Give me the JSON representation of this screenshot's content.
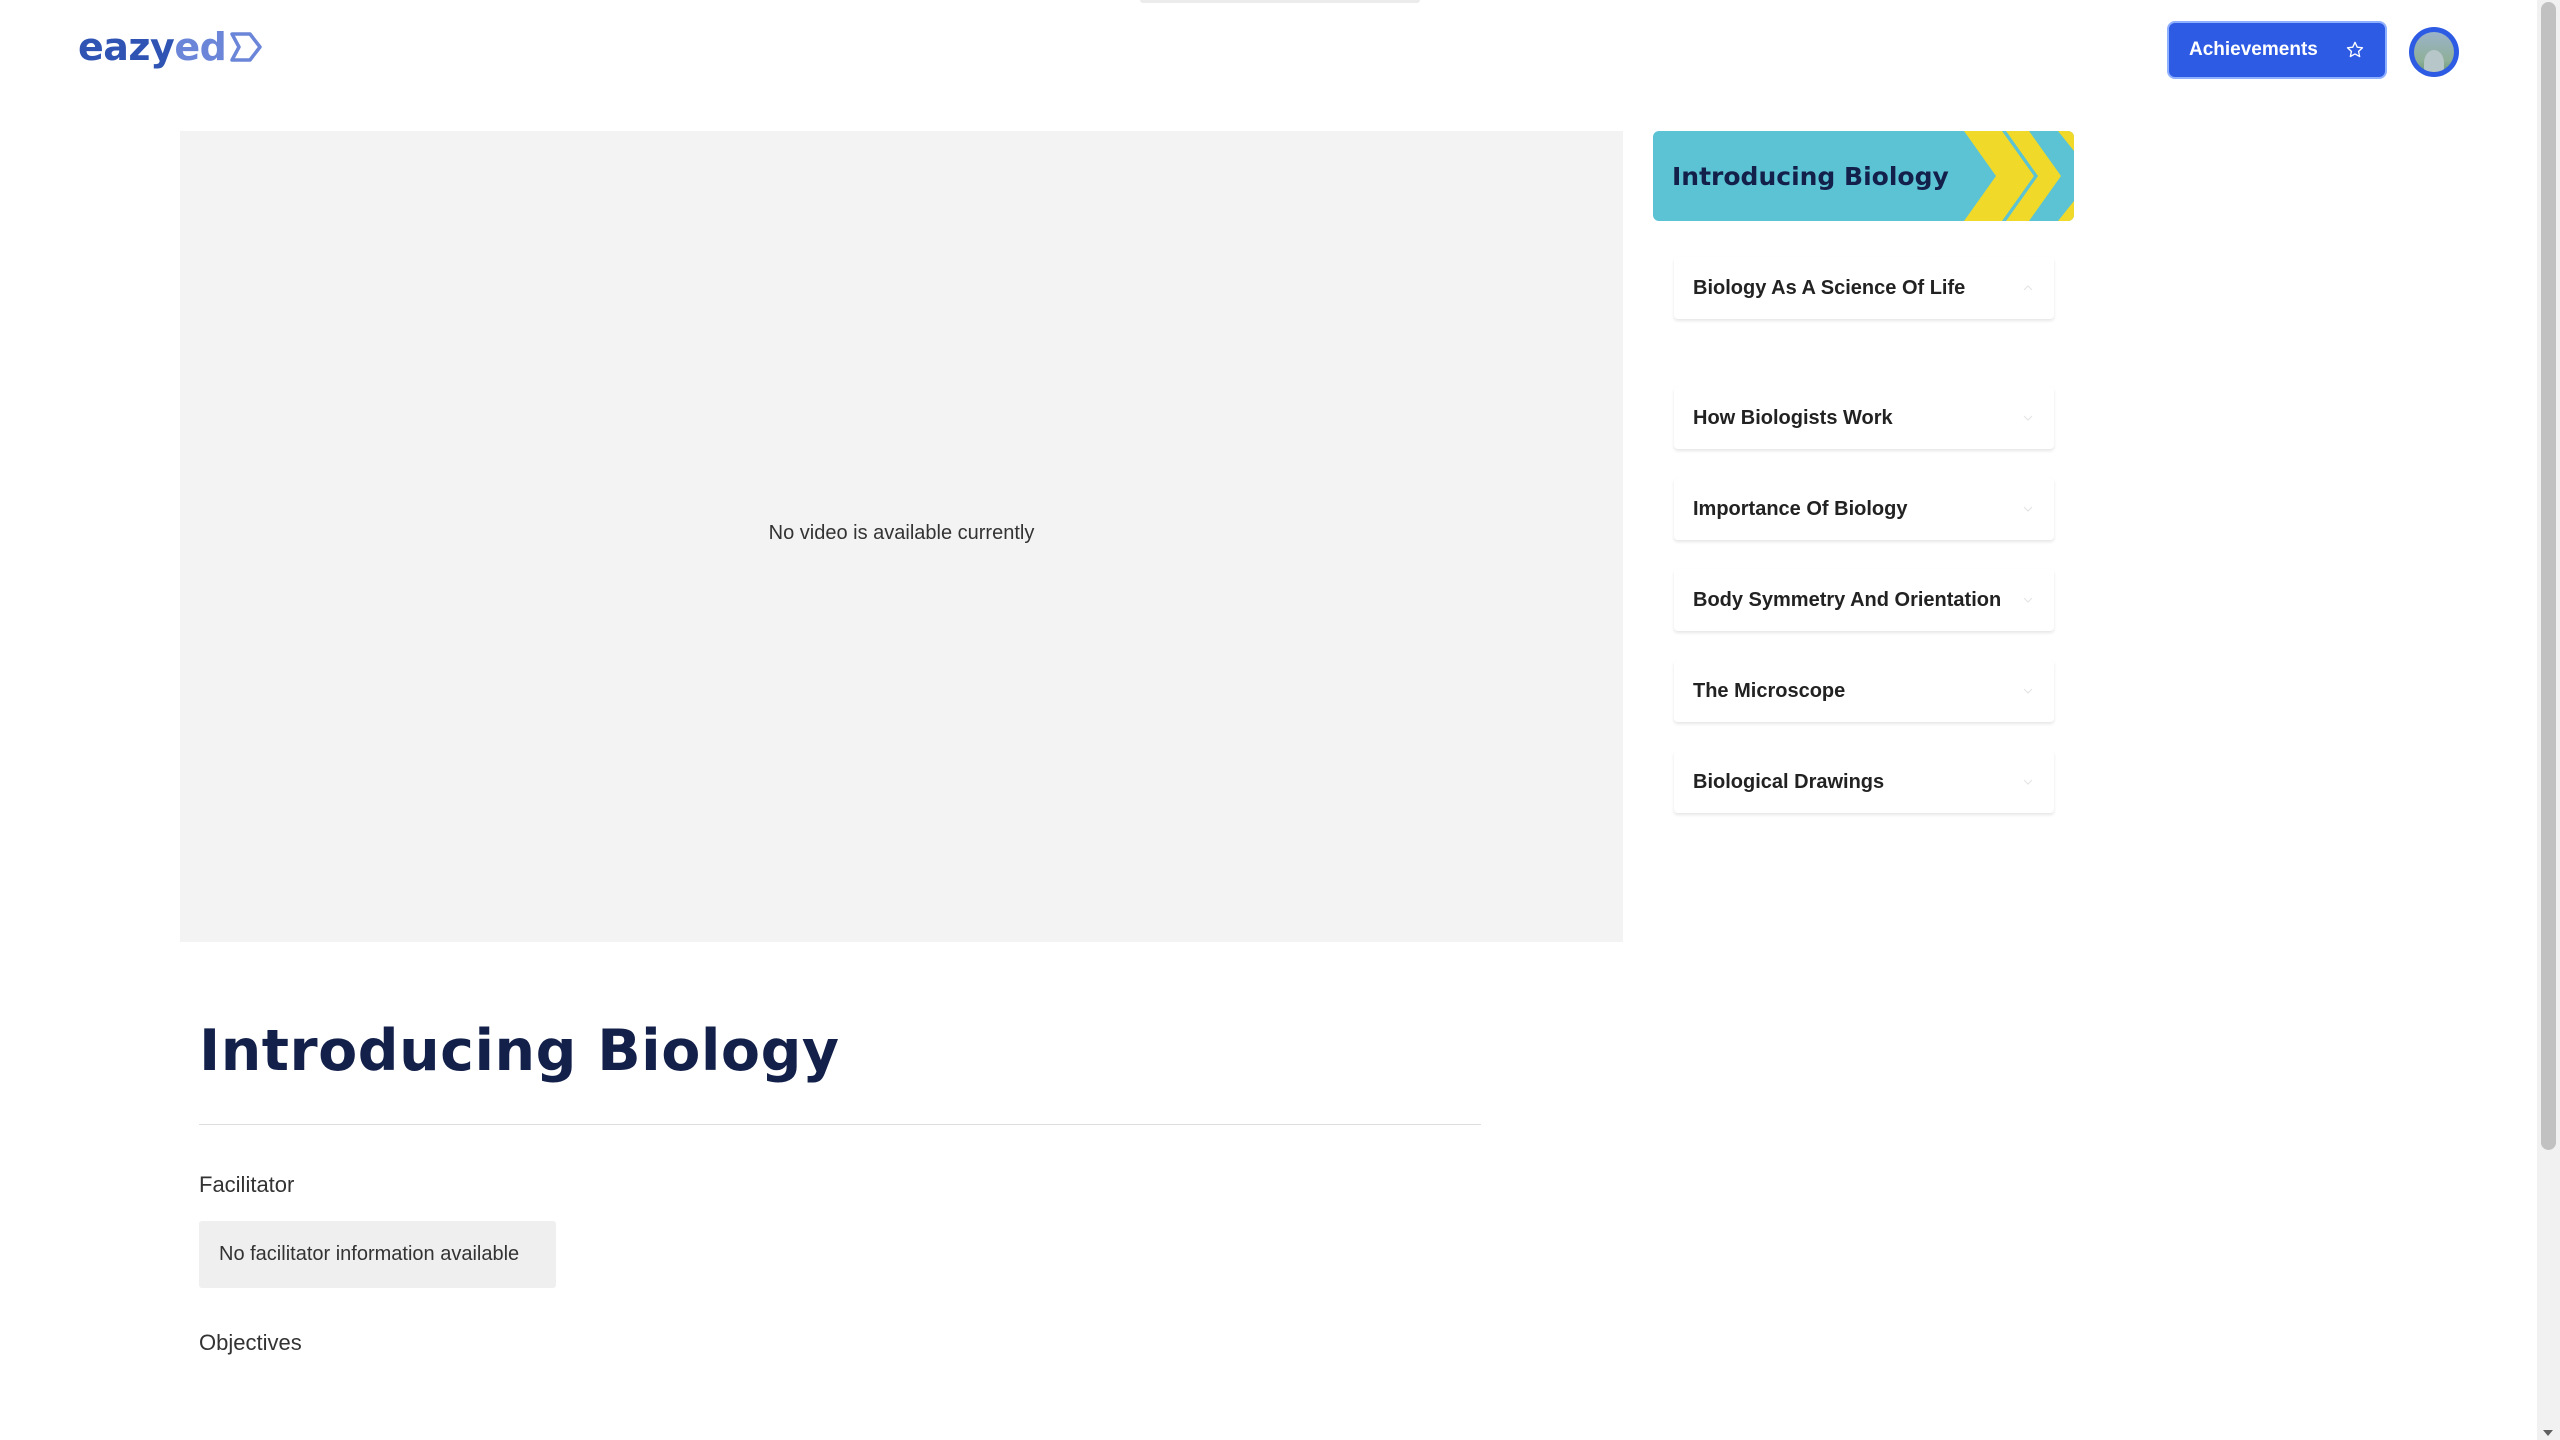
{
  "header": {
    "logo": {
      "part1": "eazy",
      "part2": "ed"
    },
    "achievements_label": "Achievements",
    "icons": {
      "achievements": "star-icon",
      "profile": "avatar"
    }
  },
  "video": {
    "message": "No video is available currently"
  },
  "sidebar": {
    "module_title": "Introducing Biology",
    "lessons": [
      {
        "label": "Biology As A Science Of Life",
        "icon": "chevron-up-icon"
      },
      {
        "label": "How Biologists Work",
        "icon": "chevron-down-icon"
      },
      {
        "label": "Importance Of Biology",
        "icon": "chevron-down-icon"
      },
      {
        "label": "Body Symmetry And Orientation",
        "icon": "chevron-down-icon"
      },
      {
        "label": "The Microscope",
        "icon": "chevron-down-icon"
      },
      {
        "label": "Biological Drawings",
        "icon": "chevron-down-icon"
      }
    ]
  },
  "main": {
    "title": "Introducing Biology",
    "facilitator_label": "Facilitator",
    "facilitator_value": "No facilitator information available",
    "objectives_label": "Objectives"
  },
  "colors": {
    "brand_blue": "#2e5be4",
    "navy": "#13204a",
    "module_teal": "#5bc3d4",
    "module_yellow": "#f0d928"
  }
}
